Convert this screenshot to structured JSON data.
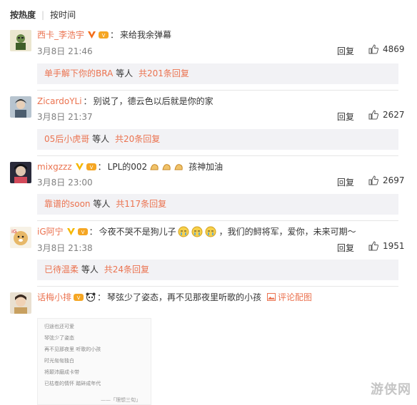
{
  "sort": {
    "hot": "按热度",
    "time": "按时间"
  },
  "comments": [
    {
      "user": "西卡_李浩宇",
      "text": "来给我余弹幕",
      "time": "3月8日 21:46",
      "reply": "回复",
      "likes": "4869",
      "sub_name": "单手解下你的BRA",
      "sub_mid": "等人",
      "sub_more": "共201条回复"
    },
    {
      "user": "ZicardoYLi",
      "text": "别说了，德云色以后就是你的家",
      "time": "3月8日 21:37",
      "reply": "回复",
      "likes": "2627",
      "sub_name": "05后小虎哥",
      "sub_mid": "等人",
      "sub_more": "共20条回复"
    },
    {
      "user": "mixgzzz",
      "text": "LPL的002",
      "text_after": "孩神加油",
      "time": "3月8日 23:00",
      "reply": "回复",
      "likes": "2697",
      "sub_name": "靠谱的soon",
      "sub_mid": "等人",
      "sub_more": "共117条回复"
    },
    {
      "user": "iG阿宁",
      "text": "今夜不哭不是狗儿子",
      "text_after": "，我们的鲟将军，爱你，未来可期～",
      "time": "3月8日 21:38",
      "reply": "回复",
      "likes": "1951",
      "sub_name": "已待温柔",
      "sub_mid": "等人",
      "sub_more": "共24条回复"
    },
    {
      "user": "话梅小排",
      "text": "琴弦少了姿态，再不见那夜里听歌的小孩",
      "link": "评论配图"
    }
  ],
  "image_lines": [
    "归途也还可爱",
    "琴弦少了姿态",
    "再不见那夜里 听歌的小孩",
    "时光匆匆独白",
    "将颠沛磨成卡带",
    "已枯卷的情怀 踏碎成年代"
  ],
  "image_sig": "——「理想三旬」",
  "watermark": "游侠网",
  "colors": {
    "username": "#eb7350",
    "link": "#eb7350",
    "reply_bg": "#f2f2f5"
  }
}
